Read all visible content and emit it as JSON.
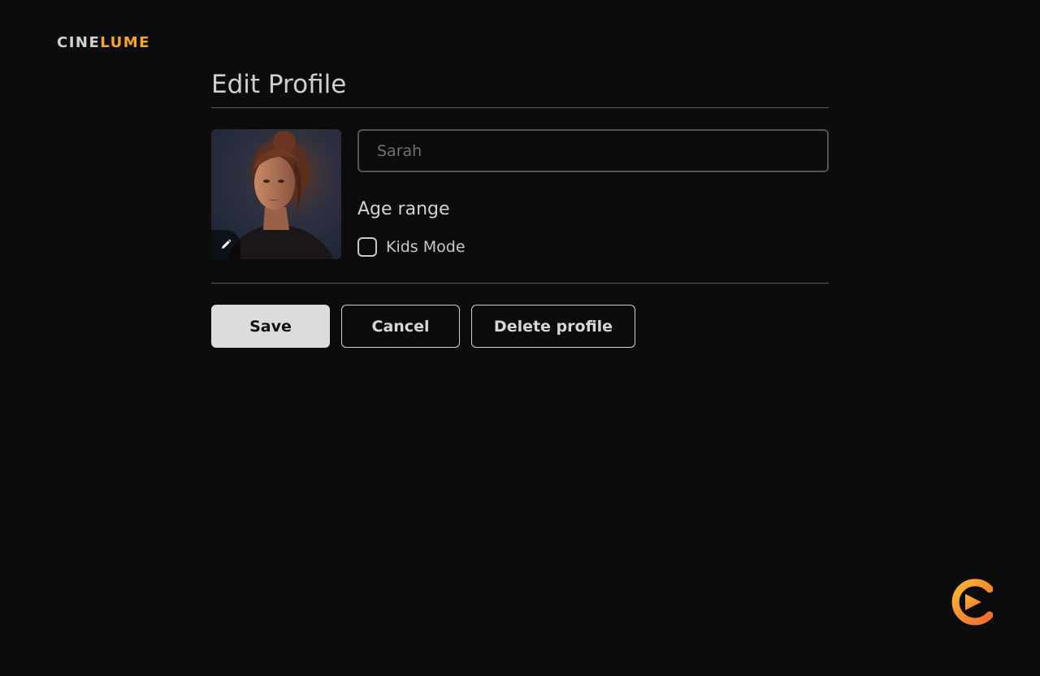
{
  "brand": {
    "logo_part1": "CINE",
    "logo_part2": "LUME",
    "accent_color": "#f5a623",
    "mark_icon": "cinelume-play-logo-icon"
  },
  "page": {
    "title": "Edit Profile"
  },
  "profile": {
    "avatar_icon": "profile-avatar-photo",
    "edit_icon": "pencil-icon",
    "name_placeholder": "Sarah",
    "age_range_label": "Age range",
    "kids_mode_label": "Kids Mode",
    "kids_mode_checked": false
  },
  "actions": {
    "save_label": "Save",
    "cancel_label": "Cancel",
    "delete_label": "Delete profile"
  }
}
